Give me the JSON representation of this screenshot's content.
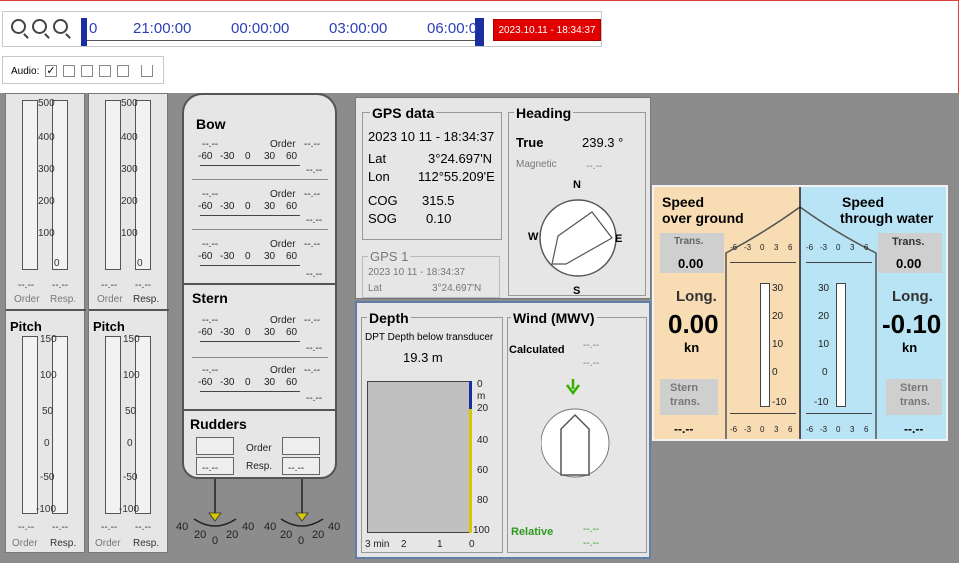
{
  "timeline": {
    "labels": [
      "0",
      "21:00:00",
      "00:00:00",
      "03:00:00",
      "06:00:0"
    ],
    "current": "2023.10.11 - 18:34:37"
  },
  "audio": {
    "label": "Audio:"
  },
  "gauges": {
    "upper_ticks": [
      "500",
      "400",
      "300",
      "200",
      "100",
      "0"
    ],
    "order_label": "Order",
    "resp_label": "Resp.",
    "dashes": "--.--",
    "pitch_label": "Pitch",
    "pitch_ticks": [
      "150",
      "100",
      "50",
      "0",
      "-50",
      "-100"
    ]
  },
  "thrusters": {
    "bow_label": "Bow",
    "stern_label": "Stern",
    "rudders_label": "Rudders",
    "order_label": "Order",
    "resp_label": "Resp.",
    "scale": [
      "-60",
      "-30",
      "0",
      "30",
      "60"
    ],
    "dash": "--.--",
    "dash2": "--.--",
    "rudder_ticks": [
      "40",
      "20",
      "0",
      "20",
      "40"
    ]
  },
  "gps": {
    "title": "GPS data",
    "datetime": "2023 10 11 - 18:34:37",
    "lat_label": "Lat",
    "lat": "3°24.697'N",
    "lon_label": "Lon",
    "lon": "112°55.209'E",
    "cog_label": "COG",
    "cog": "315.5",
    "sog_label": "SOG",
    "sog": "0.10",
    "gps1_title": "GPS 1",
    "gps1_datetime": "2023 10 11 - 18:34:37",
    "gps1_lat": "3°24.697'N"
  },
  "heading": {
    "title": "Heading",
    "true_label": "True",
    "true_value": "239.3 °",
    "magnetic_label": "Magnetic",
    "magnetic_value": "--.--",
    "compass": [
      "N",
      "E",
      "S",
      "W"
    ]
  },
  "depth": {
    "title": "Depth",
    "subtitle": "DPT Depth below transducer",
    "value": "19.3  m",
    "unit": "m",
    "scale": [
      "0",
      "20",
      "40",
      "60",
      "80",
      "100"
    ],
    "time_axis": [
      "3 min",
      "2",
      "1",
      "0"
    ]
  },
  "wind": {
    "title": "Wind (MWV)",
    "calculated_label": "Calculated",
    "relative_label": "Relative",
    "dash": "--.--"
  },
  "speed": {
    "sog_title_1": "Speed",
    "sog_title_2": "over ground",
    "stw_title_1": "Speed",
    "stw_title_2": "through water",
    "trans_label": "Trans.",
    "long_label": "Long.",
    "stern_label_1": "Stern",
    "stern_label_2": "trans.",
    "sog_trans": "0.00",
    "sog_long": "0.00",
    "sog_unit": "kn",
    "sog_stern": "--.--",
    "stw_trans": "0.00",
    "stw_long": "-0.10",
    "stw_unit": "kn",
    "stw_stern": "--.--",
    "small_scale": [
      "-6",
      "-3",
      "0",
      "3",
      "6"
    ],
    "vert_scale": [
      "30",
      "20",
      "10",
      "0",
      "-10"
    ]
  },
  "colors": {
    "sog_bg": "#f7dcb4",
    "stw_bg": "#b8e4f5",
    "badge": "#e00000",
    "time_blue": "#2b3fb8"
  }
}
